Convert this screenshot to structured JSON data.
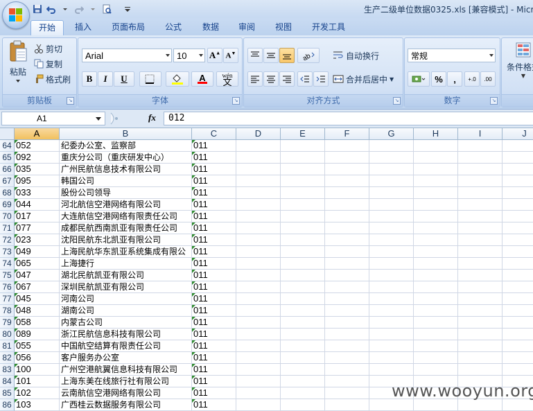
{
  "window": {
    "title": "生产二级单位数据0325.xls  [兼容模式] - Micr"
  },
  "quick_access": [
    "save-icon",
    "undo-icon",
    "redo-icon",
    "print-preview-icon",
    "customize-icon"
  ],
  "tabs": [
    {
      "label": "开始",
      "active": true
    },
    {
      "label": "插入",
      "active": false
    },
    {
      "label": "页面布局",
      "active": false
    },
    {
      "label": "公式",
      "active": false
    },
    {
      "label": "数据",
      "active": false
    },
    {
      "label": "审阅",
      "active": false
    },
    {
      "label": "视图",
      "active": false
    },
    {
      "label": "开发工具",
      "active": false
    }
  ],
  "ribbon": {
    "clipboard": {
      "label": "剪贴板",
      "paste": "粘贴",
      "cut": "剪切",
      "copy": "复制",
      "format_painter": "格式刷"
    },
    "font": {
      "label": "字体",
      "font_name": "Arial",
      "font_size": "10",
      "bold": "B",
      "italic": "I",
      "underline": "U",
      "font_color_glyph": "A",
      "phonetic_glyph": "wén"
    },
    "alignment": {
      "label": "对齐方式",
      "wrap_text": "自动换行",
      "merge_center": "合并后居中"
    },
    "number": {
      "label": "数字",
      "format": "常规",
      "percent": "%",
      "comma": ",",
      "increase_decimal": "+.0",
      "decrease_decimal": ".00"
    },
    "styles": {
      "conditional_format": "条件格式"
    }
  },
  "formula_bar": {
    "name_box": "A1",
    "fx": "fx",
    "value": "012"
  },
  "columns": [
    "A",
    "B",
    "C",
    "D",
    "E",
    "F",
    "G",
    "H",
    "I",
    "J"
  ],
  "selected_column": "A",
  "rows": [
    {
      "n": "64",
      "a": "052",
      "b": "纪委办公室、监察部",
      "c": "011"
    },
    {
      "n": "65",
      "a": "092",
      "b": "重庆分公司（重庆研发中心）",
      "c": "011"
    },
    {
      "n": "66",
      "a": "035",
      "b": "广州民航信息技术有限公司",
      "c": "011"
    },
    {
      "n": "67",
      "a": "095",
      "b": "韩国公司",
      "c": "011"
    },
    {
      "n": "68",
      "a": "033",
      "b": "股份公司领导",
      "c": "011"
    },
    {
      "n": "69",
      "a": "044",
      "b": "河北航信空港网络有限公司",
      "c": "011"
    },
    {
      "n": "70",
      "a": "017",
      "b": "大连航信空港网络有限责任公司",
      "c": "011"
    },
    {
      "n": "71",
      "a": "077",
      "b": "成都民航西南凯亚有限责任公司",
      "c": "011"
    },
    {
      "n": "72",
      "a": "023",
      "b": "沈阳民航东北凯亚有限公司",
      "c": "011"
    },
    {
      "n": "73",
      "a": "049",
      "b": "上海民航华东凯亚系统集成有限公",
      "c": "011"
    },
    {
      "n": "74",
      "a": "065",
      "b": "上海捷行",
      "c": "011"
    },
    {
      "n": "75",
      "a": "047",
      "b": "湖北民航凯亚有限公司",
      "c": "011"
    },
    {
      "n": "76",
      "a": "067",
      "b": "深圳民航凯亚有限公司",
      "c": "011"
    },
    {
      "n": "77",
      "a": "045",
      "b": "河南公司",
      "c": "011"
    },
    {
      "n": "78",
      "a": "048",
      "b": "湖南公司",
      "c": "011"
    },
    {
      "n": "79",
      "a": "058",
      "b": "内蒙古公司",
      "c": "011"
    },
    {
      "n": "80",
      "a": "089",
      "b": "浙江民航信息科技有限公司",
      "c": "011"
    },
    {
      "n": "81",
      "a": "055",
      "b": "中国航空结算有限责任公司",
      "c": "011"
    },
    {
      "n": "82",
      "a": "056",
      "b": "客户服务办公室",
      "c": "011"
    },
    {
      "n": "83",
      "a": "100",
      "b": "广州空港航翼信息科技有限公司",
      "c": "011"
    },
    {
      "n": "84",
      "a": "101",
      "b": "上海东美在线旅行社有限公司",
      "c": "011"
    },
    {
      "n": "85",
      "a": "102",
      "b": "云南航信空港网络有限公司",
      "c": "011"
    },
    {
      "n": "86",
      "a": "103",
      "b": "广西桂云数据服务有限公司",
      "c": "011"
    }
  ],
  "watermark": "www.wooyun.org"
}
